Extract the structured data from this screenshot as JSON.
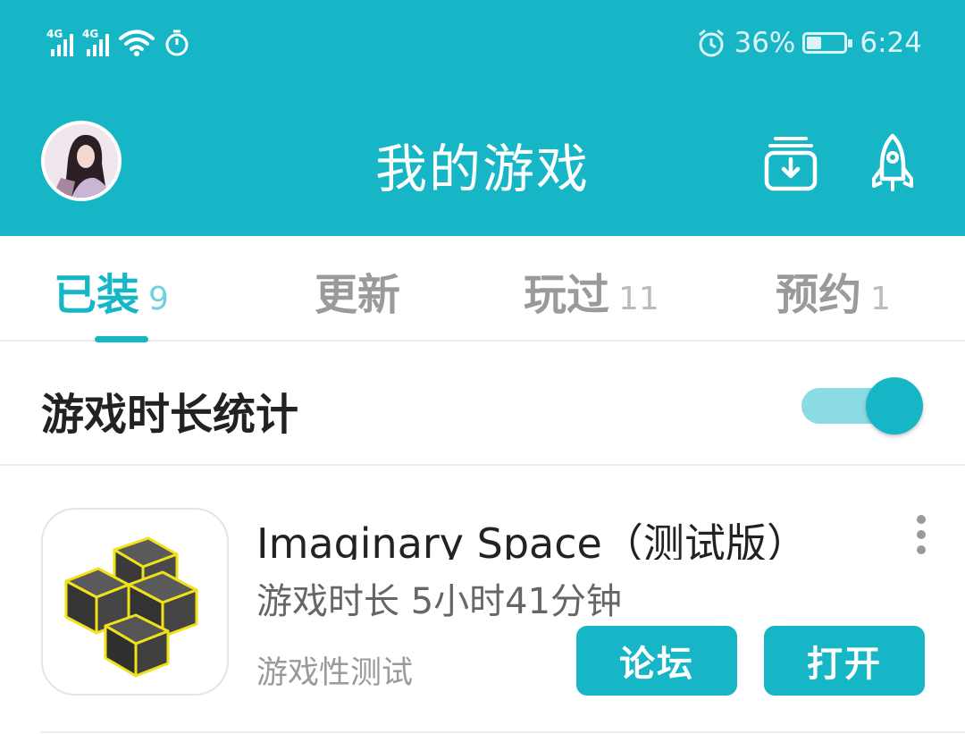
{
  "status_bar": {
    "network_1": "4G",
    "network_2": "4G",
    "battery_percent": "36%",
    "battery_level": 0.36,
    "time": "6:24"
  },
  "header": {
    "title": "我的游戏",
    "background_color": "#16b6c7",
    "icons": [
      "avatar",
      "download-box-icon",
      "rocket-icon"
    ]
  },
  "tabs": [
    {
      "label": "已装",
      "count": "9",
      "active": true
    },
    {
      "label": "更新",
      "count": "",
      "active": false
    },
    {
      "label": "玩过",
      "count": "11",
      "active": false
    },
    {
      "label": "预约",
      "count": "1",
      "active": false
    }
  ],
  "stats": {
    "label": "游戏时长统计",
    "toggle_on": true
  },
  "games": [
    {
      "title": "Imaginary Space（测试版）",
      "play_time": "游戏时长 5小时41分钟",
      "tag": "游戏性测试",
      "buttons": {
        "forum": "论坛",
        "open": "打开"
      }
    }
  ],
  "colors": {
    "accent": "#16b6c7",
    "toggle_track": "#8adbe3"
  }
}
